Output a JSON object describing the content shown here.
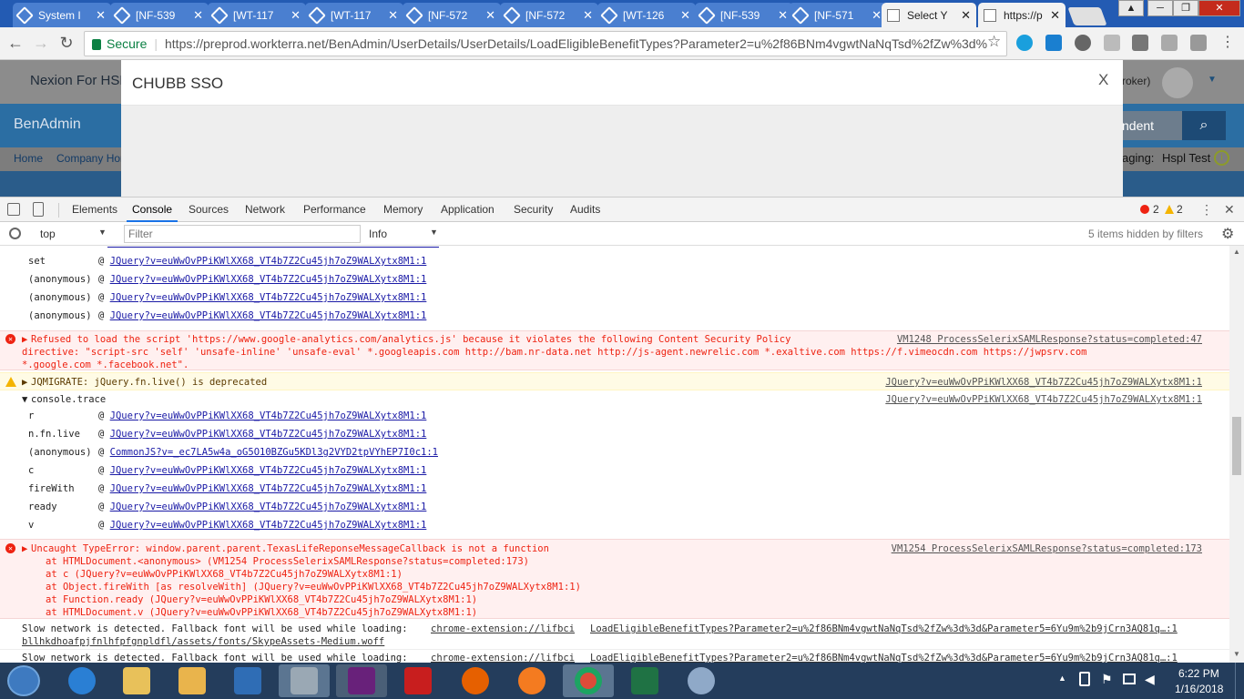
{
  "browser": {
    "tabs": [
      {
        "title": "System I",
        "active": false
      },
      {
        "title": "[NF-539",
        "active": false
      },
      {
        "title": "[WT-117",
        "active": false
      },
      {
        "title": "[WT-117",
        "active": false
      },
      {
        "title": "[NF-572",
        "active": false
      },
      {
        "title": "[NF-572",
        "active": false
      },
      {
        "title": "[WT-126",
        "active": false
      },
      {
        "title": "[NF-539",
        "active": false
      },
      {
        "title": "[NF-571",
        "active": false
      },
      {
        "title": "Select Y",
        "active": true
      },
      {
        "title": "https://p",
        "active": false
      }
    ],
    "secure_label": "Secure",
    "url": "https://preprod.workterra.net/BenAdmin/UserDetails/UserDetails/LoadEligibleBenefitTypes?Parameter2=u%2f86BNm4vgwtNaNqTsd%2fZw%3d%"
  },
  "page": {
    "company": "Nexion For HSP",
    "broker": "roker)",
    "nav_title": "BenAdmin",
    "search_text": "ndent",
    "breadcrumb_home": "Home",
    "breadcrumb_company": "Company Hor",
    "managing": "aging:",
    "managing_value": "Hspl Test"
  },
  "modal": {
    "title": "CHUBB SSO",
    "close_label": "X"
  },
  "devtools": {
    "tabs": [
      "Elements",
      "Console",
      "Sources",
      "Network",
      "Performance",
      "Memory",
      "Application",
      "Security",
      "Audits"
    ],
    "active_tab": "Console",
    "error_count": "2",
    "warn_count": "2",
    "context": "top",
    "filter_placeholder": "Filter",
    "level": "Info",
    "hidden_text": "5 items hidden by filters"
  },
  "console": {
    "trace1": [
      {
        "fn": "set",
        "src": "JQuery?v=euWwOvPPiKWlXX68_VT4b7Z2Cu45jh7oZ9WALXytx8M1:1"
      },
      {
        "fn": "(anonymous)",
        "src": "JQuery?v=euWwOvPPiKWlXX68_VT4b7Z2Cu45jh7oZ9WALXytx8M1:1"
      },
      {
        "fn": "(anonymous)",
        "src": "JQuery?v=euWwOvPPiKWlXX68_VT4b7Z2Cu45jh7oZ9WALXytx8M1:1"
      },
      {
        "fn": "(anonymous)",
        "src": "JQuery?v=euWwOvPPiKWlXX68_VT4b7Z2Cu45jh7oZ9WALXytx8M1:1"
      }
    ],
    "csp_error": {
      "line1": "Refused to load the script 'https://www.google-analytics.com/analytics.js' because it violates the following Content Security Policy",
      "line2": "directive: \"script-src 'self'  'unsafe-inline' 'unsafe-eval' *.googleapis.com http://bam.nr-data.net http://js-agent.newrelic.com *.exaltive.com https://f.vimeocdn.com https://jwpsrv.com",
      "line3": "*.google.com *.facebook.net\".",
      "source": "VM1248 ProcessSelerixSAMLResponse?status=completed:47"
    },
    "warning": {
      "text": "JQMIGRATE: jQuery.fn.live() is deprecated",
      "source": "JQuery?v=euWwOvPPiKWlXX68_VT4b7Z2Cu45jh7oZ9WALXytx8M1:1"
    },
    "trace_header": {
      "text": "console.trace",
      "source": "JQuery?v=euWwOvPPiKWlXX68_VT4b7Z2Cu45jh7oZ9WALXytx8M1:1"
    },
    "trace2": [
      {
        "fn": "r",
        "src": "JQuery?v=euWwOvPPiKWlXX68_VT4b7Z2Cu45jh7oZ9WALXytx8M1:1"
      },
      {
        "fn": "n.fn.live",
        "src": "JQuery?v=euWwOvPPiKWlXX68_VT4b7Z2Cu45jh7oZ9WALXytx8M1:1"
      },
      {
        "fn": "(anonymous)",
        "src": "CommonJS?v=_ec7LA5w4a_oG5O10BZGu5KDl3g2VYD2tpVYhEP7I0c1:1"
      },
      {
        "fn": "c",
        "src": "JQuery?v=euWwOvPPiKWlXX68_VT4b7Z2Cu45jh7oZ9WALXytx8M1:1"
      },
      {
        "fn": "fireWith",
        "src": "JQuery?v=euWwOvPPiKWlXX68_VT4b7Z2Cu45jh7oZ9WALXytx8M1:1"
      },
      {
        "fn": "ready",
        "src": "JQuery?v=euWwOvPPiKWlXX68_VT4b7Z2Cu45jh7oZ9WALXytx8M1:1"
      },
      {
        "fn": "v",
        "src": "JQuery?v=euWwOvPPiKWlXX68_VT4b7Z2Cu45jh7oZ9WALXytx8M1:1"
      }
    ],
    "type_error": {
      "title": "Uncaught TypeError: window.parent.parent.TexasLifeReponseMessageCallback is not a function",
      "source": "VM1254 ProcessSelerixSAMLResponse?status=completed:173",
      "stack": [
        "at HTMLDocument.<anonymous> (VM1254 ProcessSelerixSAMLResponse?status=completed:173)",
        "at c (JQuery?v=euWwOvPPiKWlXX68_VT4b7Z2Cu45jh7oZ9WALXytx8M1:1)",
        "at Object.fireWith [as resolveWith] (JQuery?v=euWwOvPPiKWlXX68_VT4b7Z2Cu45jh7oZ9WALXytx8M1:1)",
        "at Function.ready (JQuery?v=euWwOvPPiKWlXX68_VT4b7Z2Cu45jh7oZ9WALXytx8M1:1)",
        "at HTMLDocument.v (JQuery?v=euWwOvPPiKWlXX68_VT4b7Z2Cu45jh7oZ9WALXytx8M1:1)"
      ]
    },
    "slow1": {
      "text": "Slow network is detected. Fallback font will be used while loading:",
      "link": "chrome-extension://lifbci",
      "source": "LoadEligibleBenefitTypes?Parameter2=u%2f86BNm4vgwtNaNqTsd%2fZw%3d%3d&Parameter5=6Yu9m%2b9jCrn3AQ81q…:1",
      "line2": "bllhkdhoafpjfnlhfpfgnpldfl/assets/fonts/SkypeAssets-Medium.woff"
    },
    "slow2": {
      "text": "Slow network is detected. Fallback font will be used while loading:",
      "link": "chrome-extension://lifbci",
      "source": "LoadEligibleBenefitTypes?Parameter2=u%2f86BNm4vgwtNaNqTsd%2fZw%3d%3d&Parameter5=6Yu9m%2b9jCrn3AQ81q…:1"
    }
  },
  "taskbar": {
    "time": "6:22 PM",
    "date": "1/16/2018"
  },
  "colors": {
    "tabstrip": "#235bb3",
    "nav_blue": "#2b6ea3",
    "error_red": "#e21",
    "link_blue": "#1a1aa6",
    "taskbar": "#243d5c"
  }
}
